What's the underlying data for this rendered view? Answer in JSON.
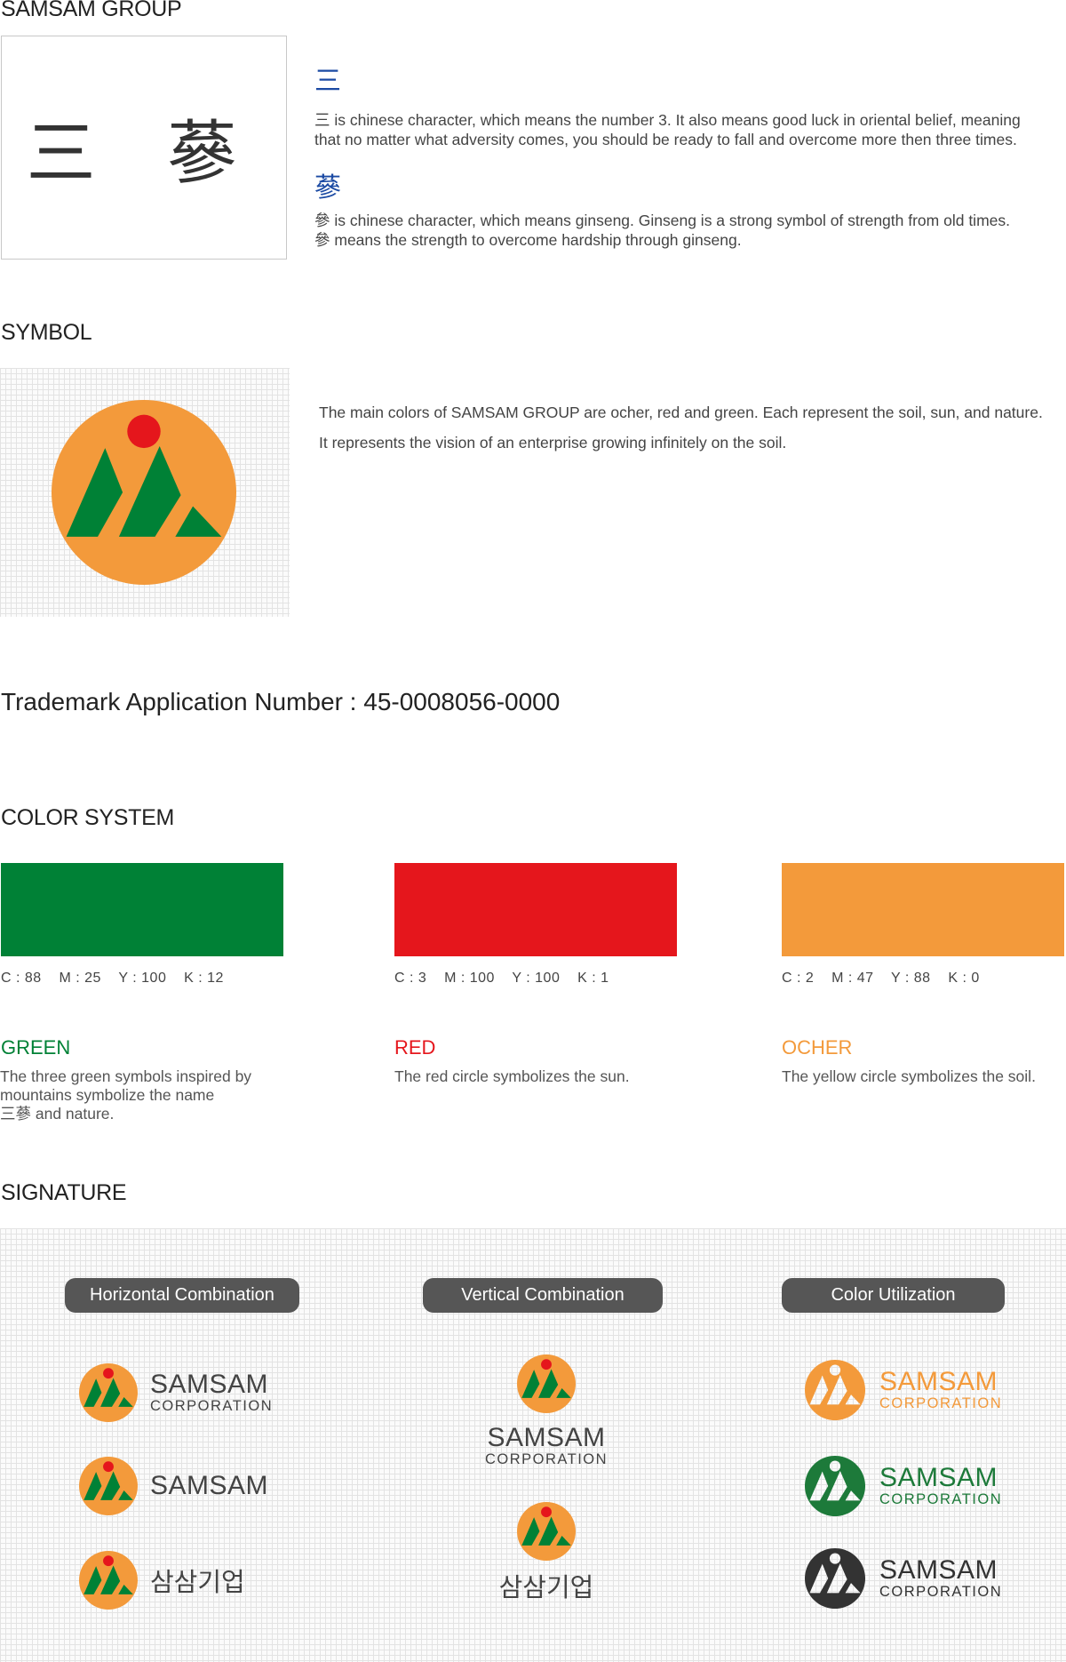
{
  "colors": {
    "green": "#008136",
    "red": "#e5161c",
    "ocher": "#f39a3b",
    "blue_char": "#1b4aa3",
    "pill_bg": "#565656"
  },
  "group": {
    "title": "SAMSAM GROUP",
    "box_text": "三 蔘",
    "char1": "三",
    "char1_line1": "三 is chinese character, which means the number 3. It also means good luck in oriental belief, meaning",
    "char1_line2": "that no matter what adversity comes, you should be ready to fall and overcome more then three times.",
    "char2": "蔘",
    "char2_line1": "參 is chinese character, which means ginseng. Ginseng is a strong symbol of strength from old times.",
    "char2_line2": "參 means the strength to overcome hardship through ginseng."
  },
  "symbol": {
    "title": "SYMBOL",
    "line1": "The main colors of SAMSAM GROUP are ocher, red and green. Each represent the soil, sun, and nature.",
    "line2": "It represents the vision of an enterprise growing infinitely on the soil."
  },
  "trademark": "Trademark Application Number : 45-0008056-0000",
  "color_system": {
    "title": "COLOR SYSTEM",
    "items": [
      {
        "cmyk": "C : 88    M : 25    Y : 100    K : 12",
        "name": "GREEN",
        "desc1": "The three green symbols inspired by",
        "desc2": "mountains symbolize the name",
        "desc3": "三蔘 and nature."
      },
      {
        "cmyk": "C : 3    M : 100    Y : 100    K : 1",
        "name": "RED",
        "desc1": "The red circle symbolizes the sun.",
        "desc2": "",
        "desc3": ""
      },
      {
        "cmyk": "C : 2    M : 47    Y : 88    K : 0",
        "name": "OCHER",
        "desc1": "The yellow circle symbolizes the soil.",
        "desc2": "",
        "desc3": ""
      }
    ]
  },
  "signature": {
    "title": "SIGNATURE",
    "pills": [
      "Horizontal Combination",
      "Vertical Combination",
      "Color Utilization"
    ],
    "samsam": "SAMSAM",
    "corporation": "CORPORATION",
    "korean": "삼삼기업"
  }
}
